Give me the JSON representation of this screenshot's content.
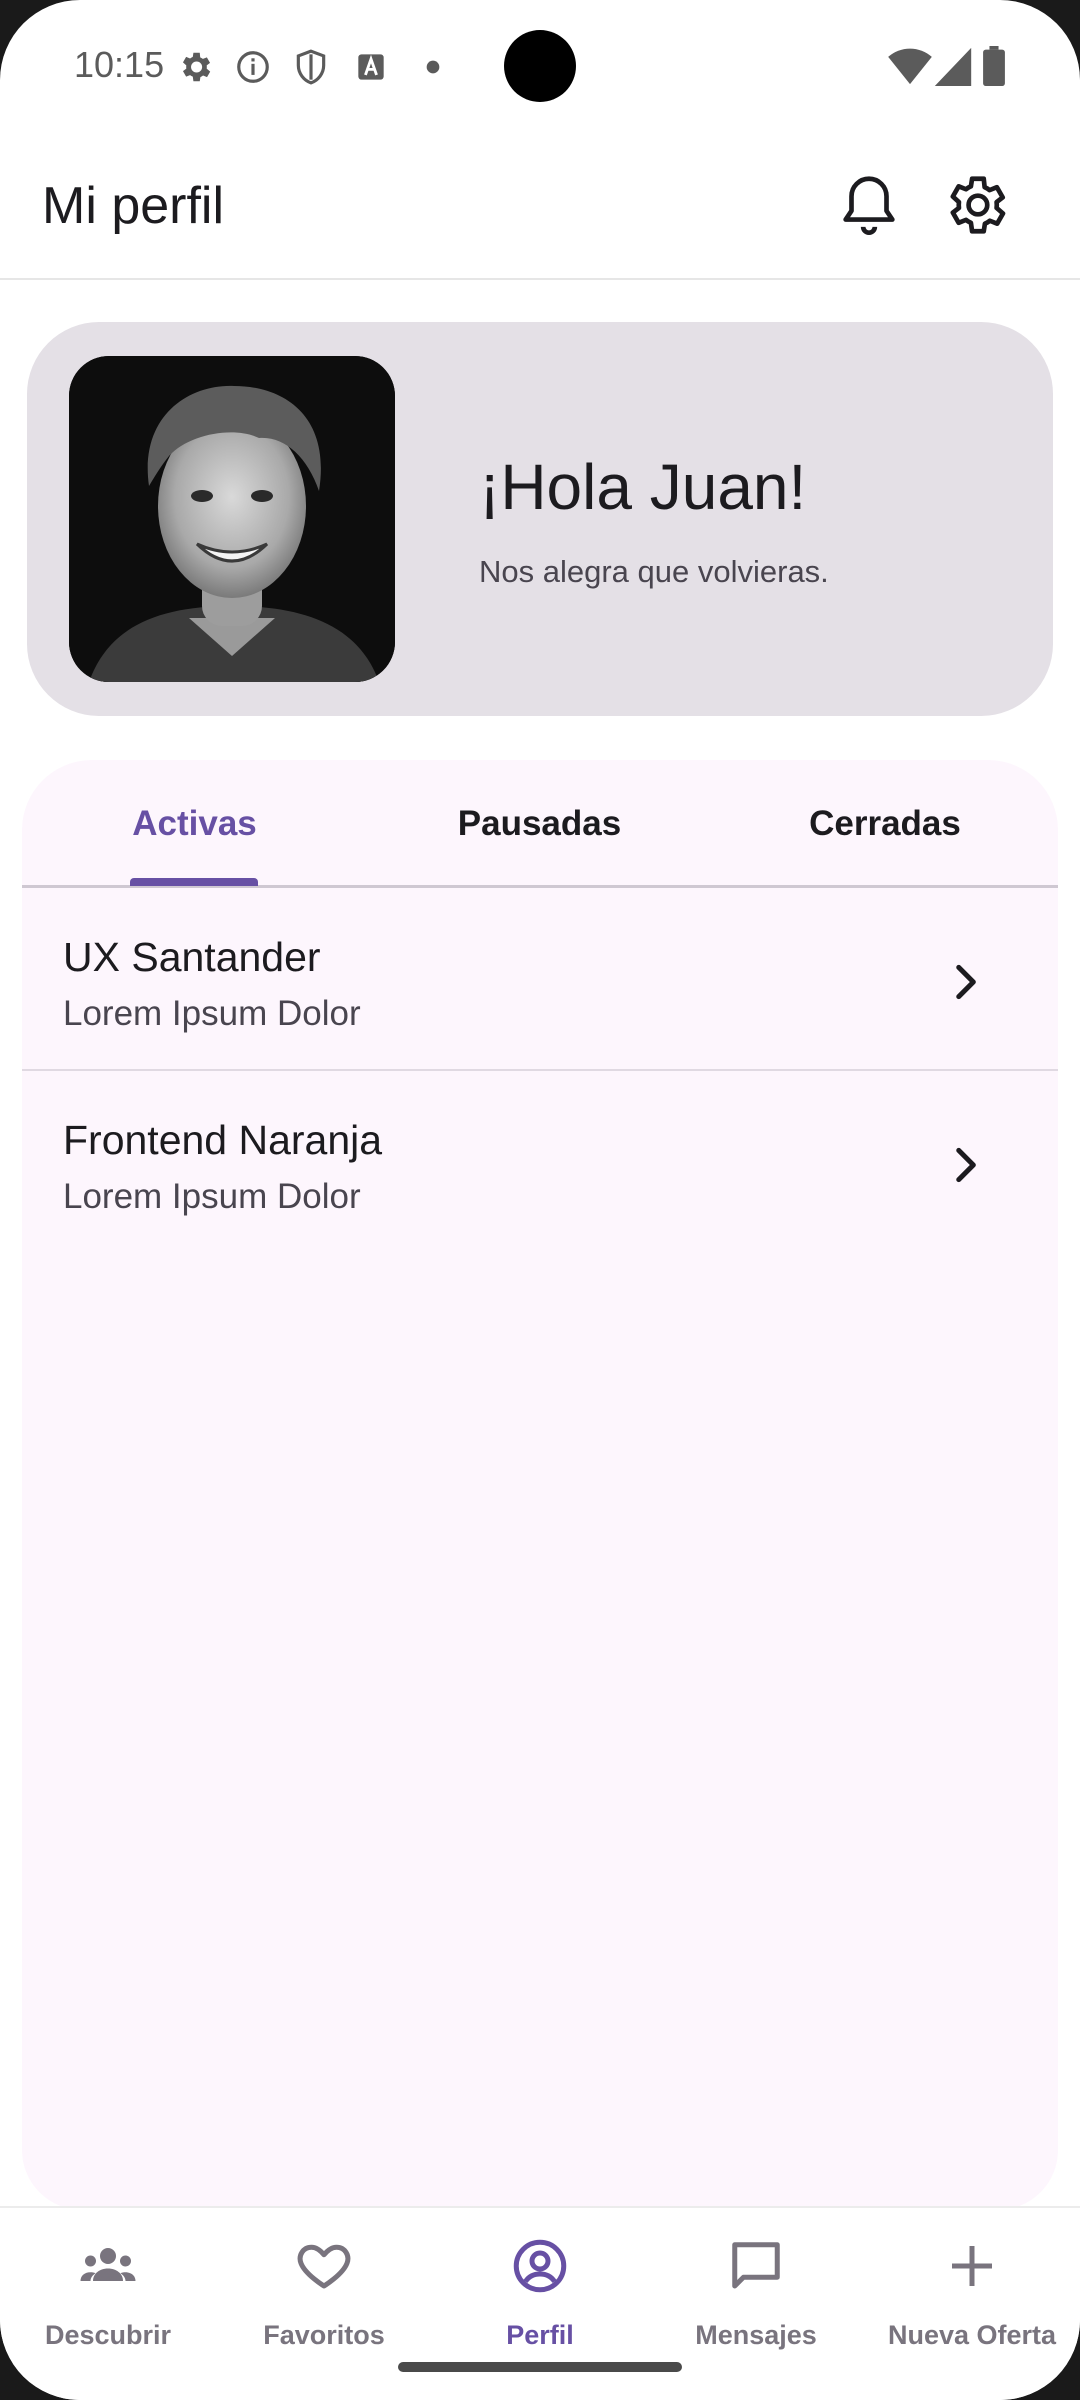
{
  "status_bar": {
    "time": "10:15",
    "left_icons": [
      "settings-icon",
      "info-icon",
      "shield-icon",
      "text-a-icon",
      "dot-icon"
    ],
    "right_icons": [
      "wifi-icon",
      "signal-icon",
      "battery-icon"
    ]
  },
  "app_bar": {
    "title": "Mi perfil",
    "actions": [
      "bell-icon",
      "gear-icon"
    ]
  },
  "greeting": {
    "title": "¡Hola Juan!",
    "subtitle": "Nos alegra que volvieras."
  },
  "tabs": [
    {
      "label": "Activas",
      "active": true
    },
    {
      "label": "Pausadas",
      "active": false
    },
    {
      "label": "Cerradas",
      "active": false
    }
  ],
  "offers": [
    {
      "title": "UX Santander",
      "subtitle": "Lorem Ipsum Dolor"
    },
    {
      "title": "Frontend Naranja",
      "subtitle": "Lorem Ipsum Dolor"
    }
  ],
  "bottom_nav": [
    {
      "label": "Descubrir",
      "icon": "people-icon",
      "active": false
    },
    {
      "label": "Favoritos",
      "icon": "heart-icon",
      "active": false
    },
    {
      "label": "Perfil",
      "icon": "account-circle-icon",
      "active": true
    },
    {
      "label": "Mensajes",
      "icon": "chat-icon",
      "active": false
    },
    {
      "label": "Nueva Oferta",
      "icon": "plus-icon",
      "active": false
    }
  ],
  "colors": {
    "accent": "#6750a4",
    "card_bg": "#e4e0e6",
    "panel_bg": "#fdf6fd",
    "text_primary": "#1c1b1f",
    "text_secondary": "#49454f",
    "nav_inactive": "#79747e"
  }
}
